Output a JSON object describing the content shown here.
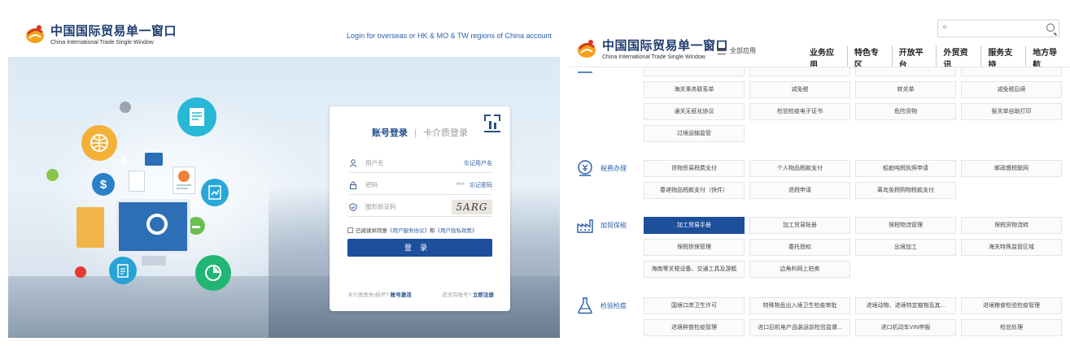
{
  "left": {
    "logo": {
      "cn": "中国国际贸易单一窗口",
      "en": "China International Trade Single Window"
    },
    "overseas_link": "Login for overseas or HK & MO & TW regions of China account",
    "login": {
      "tab_active": "账号登录",
      "tab_idle": "卡介质登录",
      "username_placeholder": "用户名",
      "forgot_username": "忘记用户名",
      "password_placeholder": "密码",
      "password_mask": "***",
      "forgot_password": "忘记密码",
      "captcha_placeholder": "图形验证码",
      "captcha_text": "5ARG",
      "agree_prefix": "已阅读并同意",
      "agree_terms": "《用户服务协议》",
      "agree_and": "和",
      "agree_privacy": "《用户隐私政策》",
      "login_button": "登录",
      "footer_left_text": "卡介质丢失/损坏?",
      "footer_left_link": "账号激活",
      "footer_right_text": "还没有账号?",
      "footer_right_link": "立即注册"
    }
  },
  "right": {
    "logo": {
      "cn": "中国国际贸易单一窗口",
      "en": "China International Trade Single Window"
    },
    "search": {
      "placeholder": ""
    },
    "all_apps": "全部应用",
    "nav": [
      "业务应用",
      "特色专区",
      "开放平台",
      "外贸资讯",
      "服务支持",
      "地方导航"
    ],
    "sections": [
      {
        "name": "",
        "icon": "clipboard-icon",
        "items": [
          "",
          "",
          "",
          "",
          "海关事务联系单",
          "减免税",
          "转关单",
          "减免税后续",
          "通关无纸化协议",
          "检验检疫电子证书",
          "危险货物",
          "报关单自助打印",
          "过境运输监管"
        ]
      },
      {
        "name": "税费办理",
        "icon": "tax-icon",
        "items": [
          "货物贸易税费支付",
          "个人物品税款支付",
          "船舶吨税执照申请",
          "邮政缴税联网",
          "春递物品税款支付（快件）",
          "退税申请",
          "离岛免税购物税款支付"
        ]
      },
      {
        "name": "加贸保税",
        "icon": "factory-icon",
        "items": [
          "加工贸易手册",
          "加工贸易账册",
          "保税物流管理",
          "保税货物流转",
          "保税担保管理",
          "委托授权",
          "出境加工",
          "海关特殊监管区域",
          "海南零关税设备、交通工具及游艇",
          "边角料网上拍卖"
        ]
      },
      {
        "name": "检验检疫",
        "icon": "flask-icon",
        "items": [
          "国境口岸卫生许可",
          "特殊物品出入境卫生检疫审批",
          "进境动物、进境特定植物及其...",
          "进境粮食检验检疫管理",
          "进境种苗检疫管理",
          "进口旧机电产品装运前检验监督...",
          "进口机动车VIN申报",
          "检验处理"
        ]
      }
    ]
  }
}
